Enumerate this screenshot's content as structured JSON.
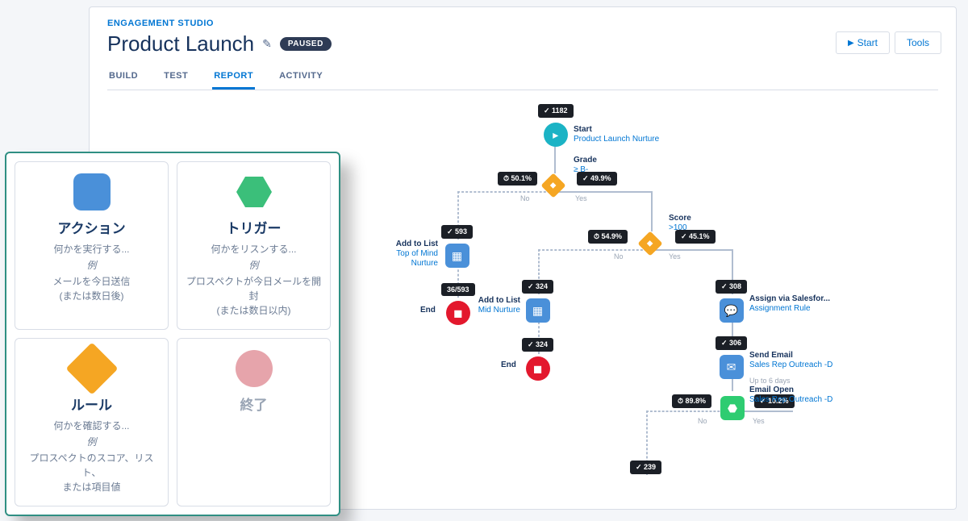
{
  "breadcrumb": "ENGAGEMENT STUDIO",
  "title": "Product Launch",
  "status": "PAUSED",
  "actions": {
    "start": "Start",
    "tools": "Tools"
  },
  "tabs": [
    "BUILD",
    "TEST",
    "REPORT",
    "ACTIVITY"
  ],
  "activeTab": 2,
  "legend": {
    "action": {
      "title": "アクション",
      "desc": "何かを実行する...",
      "eg": "例",
      "ex1": "メールを今日送信",
      "ex2": "(または数日後)"
    },
    "trigger": {
      "title": "トリガー",
      "desc": "何かをリスンする...",
      "eg": "例",
      "ex1": "プロスペクトが今日メールを開封",
      "ex2": "(または数日以内)"
    },
    "rule": {
      "title": "ルール",
      "desc": "何かを確認する...",
      "eg": "例",
      "ex1": "プロスペクトのスコア、リスト、",
      "ex2": "または項目値"
    },
    "end": {
      "title": "終了"
    }
  },
  "nodes": {
    "start": {
      "badge": "✓ 1182",
      "t1": "Start",
      "t2": "Product Launch Nurture"
    },
    "grade": {
      "left": "⏱ 50.1%",
      "right": "✓ 49.9%",
      "t1": "Grade",
      "t2": "≥ B-",
      "no": "No",
      "yes": "Yes"
    },
    "addList1": {
      "badge": "✓ 593",
      "t1": "Add to List",
      "t2": "Top of Mind Nurture"
    },
    "end1": {
      "badge": "36/593",
      "t1": "End"
    },
    "score": {
      "left": "⏱ 54.9%",
      "right": "✓ 45.1%",
      "t1": "Score",
      "t2": ">100",
      "no": "No",
      "yes": "Yes"
    },
    "addList2": {
      "badge": "✓ 324",
      "t1": "Add to List",
      "t2": "Mid Nurture"
    },
    "end2": {
      "badge": "✓ 324",
      "t1": "End"
    },
    "assign": {
      "badge": "✓ 308",
      "t1": "Assign via Salesfor...",
      "t2": "Assignment Rule"
    },
    "sendEmail": {
      "badge": "✓ 306",
      "t1": "Send Email",
      "t2": "Sales Rep Outreach -D"
    },
    "emailOpen": {
      "left": "⏱ 89.8%",
      "right": "✓ 10.2%",
      "sup": "Up to 6 days",
      "t1": "Email Open",
      "t2": "Sales Rep Outreach -D",
      "no": "No",
      "yes": "Yes"
    },
    "bottom": {
      "badge": "✓ 239"
    }
  }
}
